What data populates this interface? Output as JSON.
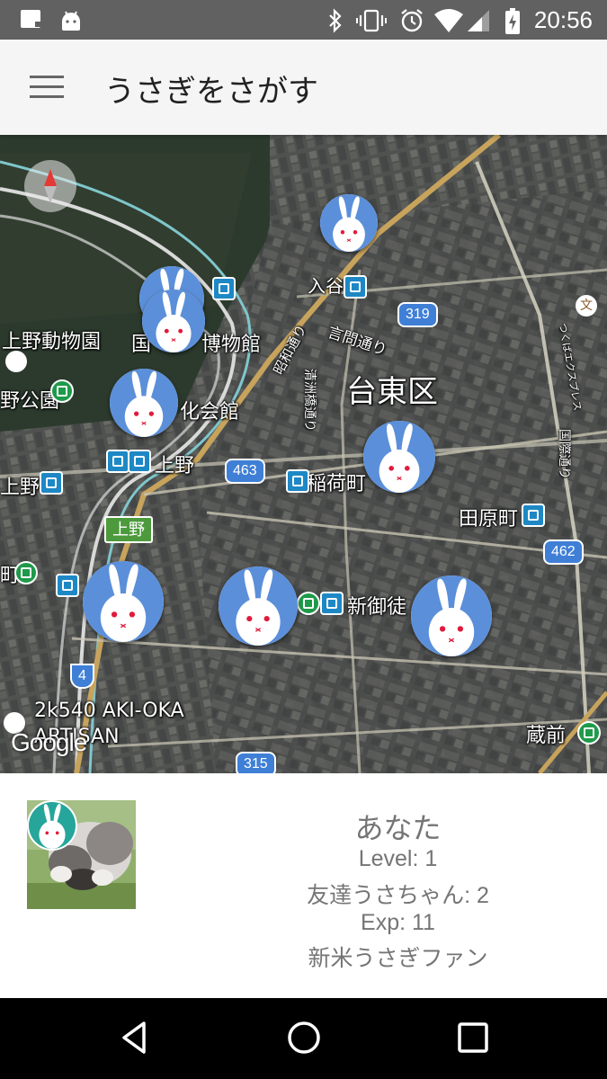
{
  "status_bar": {
    "time": "20:56",
    "icons": [
      "notification-icon",
      "android-icon",
      "bluetooth-icon",
      "vibrate-icon",
      "alarm-icon",
      "wifi-icon",
      "signal-icon",
      "battery-charging-icon"
    ]
  },
  "app_bar": {
    "title": "うさぎをさがす",
    "menu_icon": "hamburger-menu-icon"
  },
  "map": {
    "labels": {
      "district": "台東区",
      "iriya": "入谷",
      "zoo": "上野動物園",
      "park": "野公園",
      "museum_a": "国",
      "museum_b": "博物館",
      "culture": "化会館",
      "ueno1": "上野",
      "ueno2": "上野",
      "ueno_sign": "上野",
      "inaricho": "稲荷町",
      "tawaramachi": "田原町",
      "shinokachi": "新御徒",
      "kuramae": "蔵前",
      "kototoi": "言問通り",
      "shoei": "昭和通り",
      "kiyosu": "清洲橋通り",
      "kokusai": "国際通り",
      "asakusa": "つくばエクスプレス",
      "machi": "町",
      "akioka1": "2k540 AKI-OKA",
      "akioka2": "ARTISAN",
      "google": "Google"
    },
    "route_shields": {
      "r319": "319",
      "r463": "463",
      "r462": "462",
      "r4": "4",
      "r315": "315"
    }
  },
  "player": {
    "name": "あなた",
    "level": "Level: 1",
    "friends": "友達うさちゃん: 2",
    "exp": "Exp: 11",
    "rank": "新米うさぎファン"
  },
  "nav_bar": {
    "back": "back-icon",
    "home": "home-icon",
    "recents": "recents-icon"
  },
  "colors": {
    "status_bar": "#616161",
    "app_bar": "#f5f5f5",
    "rabbit_bg": "#5b8fd9",
    "route_shield": "#3f7fd6"
  }
}
